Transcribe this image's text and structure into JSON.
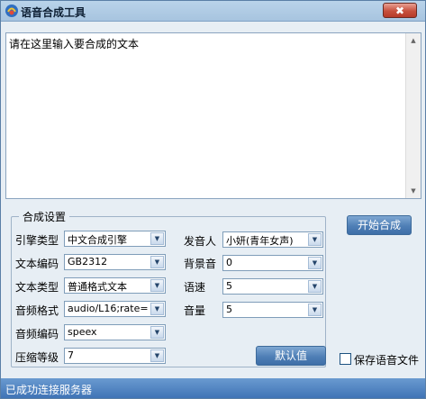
{
  "window": {
    "title": "语音合成工具",
    "close_label": "✖"
  },
  "textarea": {
    "value": "请在这里输入要合成的文本"
  },
  "settings": {
    "group_title": "合成设置",
    "engine_type": {
      "label": "引擎类型",
      "value": "中文合成引擎"
    },
    "text_encoding": {
      "label": "文本编码",
      "value": "GB2312"
    },
    "text_type": {
      "label": "文本类型",
      "value": "普通格式文本"
    },
    "audio_format": {
      "label": "音频格式",
      "value": "audio/L16;rate="
    },
    "audio_encoding": {
      "label": "音频编码",
      "value": "speex"
    },
    "compression_level": {
      "label": "压缩等级",
      "value": "7"
    },
    "speaker": {
      "label": "发音人",
      "value": "小妍(青年女声)"
    },
    "background_sound": {
      "label": "背景音",
      "value": "0"
    },
    "speed": {
      "label": "语速",
      "value": "5"
    },
    "volume": {
      "label": "音量",
      "value": "5"
    },
    "default_button": "默认值"
  },
  "start_button": "开始合成",
  "save_audio": {
    "label": "保存语音文件",
    "checked": false
  },
  "status": {
    "text": "已成功连接服务器"
  },
  "colors": {
    "status_bar": "#3f74b6",
    "button": "#4f7fb6",
    "close": "#c7503d"
  }
}
